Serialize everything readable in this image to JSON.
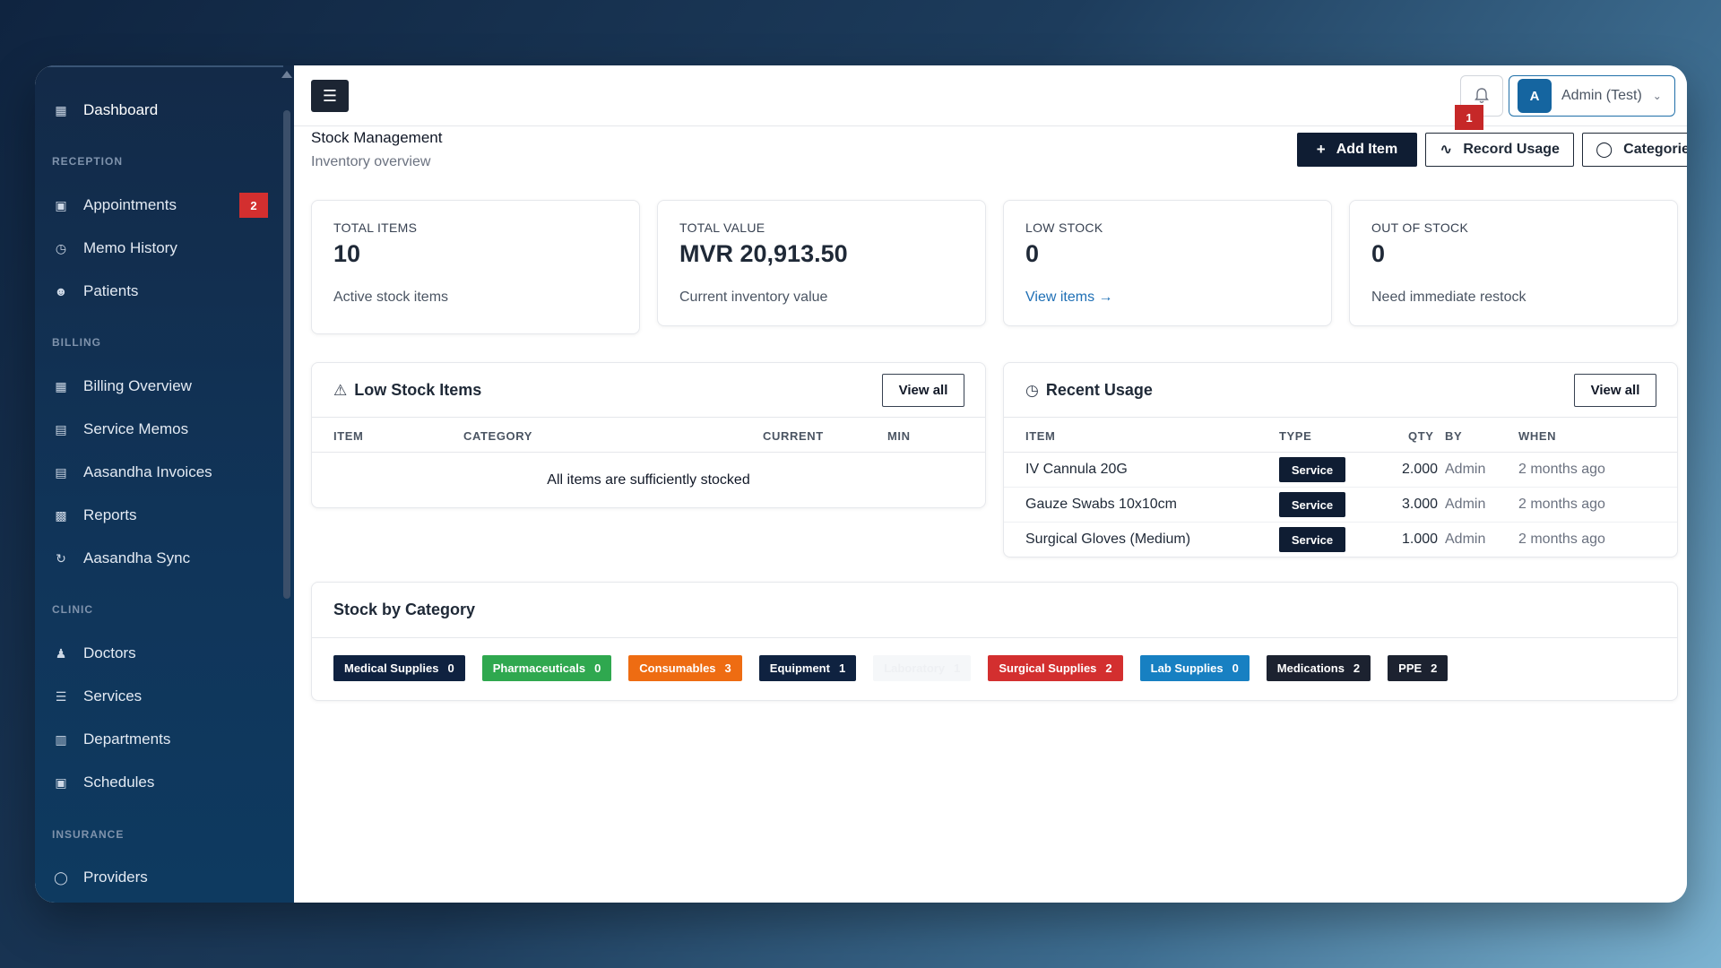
{
  "sidebar": {
    "items": [
      {
        "label": "Dashboard",
        "icon": "grid-icon"
      },
      {
        "label": "Appointments",
        "icon": "calendar-icon",
        "badge": "2"
      },
      {
        "label": "Memo History",
        "icon": "history-icon"
      },
      {
        "label": "Patients",
        "icon": "users-icon"
      },
      {
        "label": "Billing Overview",
        "icon": "grid-icon"
      },
      {
        "label": "Service Memos",
        "icon": "file-icon"
      },
      {
        "label": "Aasandha Invoices",
        "icon": "file-icon"
      },
      {
        "label": "Reports",
        "icon": "bar-chart-icon"
      },
      {
        "label": "Aasandha Sync",
        "icon": "sync-icon"
      },
      {
        "label": "Doctors",
        "icon": "user-icon"
      },
      {
        "label": "Services",
        "icon": "list-icon"
      },
      {
        "label": "Departments",
        "icon": "building-icon"
      },
      {
        "label": "Schedules",
        "icon": "calendar-icon"
      },
      {
        "label": "Providers",
        "icon": "shield-icon"
      }
    ],
    "sections": [
      "RECEPTION",
      "BILLING",
      "CLINIC",
      "INSURANCE"
    ]
  },
  "topbar": {
    "notifications_count": "1",
    "user_initial": "A",
    "user_name": "Admin (Test)"
  },
  "page": {
    "title": "Stock Management",
    "subtitle": "Inventory overview",
    "actions": {
      "add_item": "Add Item",
      "record_usage": "Record Usage",
      "categories": "Categories"
    }
  },
  "stats": [
    {
      "label": "TOTAL ITEMS",
      "value": "10",
      "note": "Active stock items"
    },
    {
      "label": "TOTAL VALUE",
      "value": "MVR 20,913.50",
      "note": "Current inventory value"
    },
    {
      "label": "LOW STOCK",
      "value": "0",
      "note": "View items →"
    },
    {
      "label": "OUT OF STOCK",
      "value": "0",
      "note": "Need immediate restock"
    }
  ],
  "low_stock": {
    "title": "Low Stock Items",
    "view_all": "View all",
    "columns": [
      "ITEM",
      "CATEGORY",
      "CURRENT",
      "MIN"
    ],
    "empty": "All items are sufficiently stocked"
  },
  "recent_usage": {
    "title": "Recent Usage",
    "view_all": "View all",
    "columns": [
      "ITEM",
      "TYPE",
      "QTY",
      "BY",
      "WHEN"
    ],
    "rows": [
      {
        "item": "IV Cannula 20G",
        "type": "Service",
        "qty": "2.000",
        "by": "Admin",
        "when": "2 months ago"
      },
      {
        "item": "Gauze Swabs 10x10cm",
        "type": "Service",
        "qty": "3.000",
        "by": "Admin",
        "when": "2 months ago"
      },
      {
        "item": "Surgical Gloves (Medium)",
        "type": "Service",
        "qty": "1.000",
        "by": "Admin",
        "when": "2 months ago"
      }
    ]
  },
  "stock_by_category": {
    "title": "Stock by Category",
    "categories": [
      {
        "name": "Medical Supplies",
        "count": "0",
        "color": "#0f2240"
      },
      {
        "name": "Pharmaceuticals",
        "count": "0",
        "color": "#2fa84f"
      },
      {
        "name": "Consumables",
        "count": "3",
        "color": "#ee6c12"
      },
      {
        "name": "Equipment",
        "count": "1",
        "color": "#0f2240"
      },
      {
        "name": "Laboratory",
        "count": "1",
        "color": "#f5f7f9"
      },
      {
        "name": "Surgical Supplies",
        "count": "2",
        "color": "#d32f2f"
      },
      {
        "name": "Lab Supplies",
        "count": "0",
        "color": "#1780c2"
      },
      {
        "name": "Medications",
        "count": "2",
        "color": "#1c2230"
      },
      {
        "name": "PPE",
        "count": "2",
        "color": "#1c2230"
      }
    ]
  }
}
